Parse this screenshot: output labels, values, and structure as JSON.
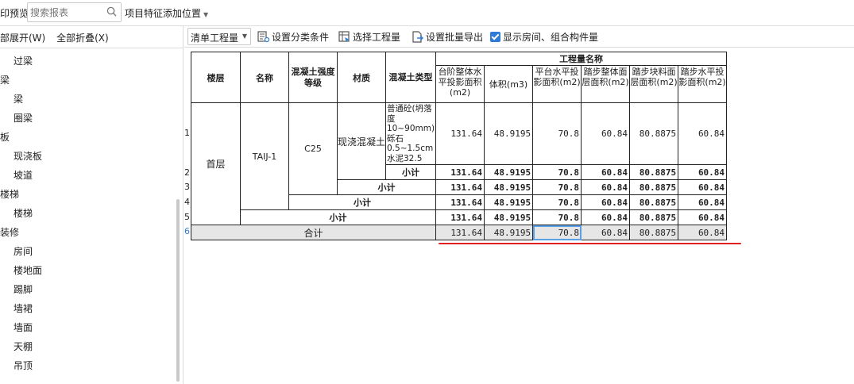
{
  "topbar": {
    "preview_label": "印预览",
    "search_placeholder": "搜索报表",
    "feature_position_label": "项目特征添加位置"
  },
  "left_panel": {
    "expand_all": "部展开(W)",
    "collapse_all": "全部折叠(X)",
    "tree": [
      {
        "label": "过梁",
        "level": 2
      },
      {
        "label": "梁",
        "level": 1
      },
      {
        "label": "梁",
        "level": 2
      },
      {
        "label": "圈梁",
        "level": 2
      },
      {
        "label": "板",
        "level": 1
      },
      {
        "label": "现浇板",
        "level": 2
      },
      {
        "label": "坡道",
        "level": 2
      },
      {
        "label": "楼梯",
        "level": 1
      },
      {
        "label": "楼梯",
        "level": 2
      },
      {
        "label": "装修",
        "level": 1
      },
      {
        "label": "房间",
        "level": 2
      },
      {
        "label": "楼地面",
        "level": 2
      },
      {
        "label": "踢脚",
        "level": 2
      },
      {
        "label": "墙裙",
        "level": 2
      },
      {
        "label": "墙面",
        "level": 2
      },
      {
        "label": "天棚",
        "level": 2
      },
      {
        "label": "吊顶",
        "level": 2
      }
    ]
  },
  "toolbar": {
    "mode_select": "清单工程量",
    "set_category": "设置分类条件",
    "select_quantity": "选择工程量",
    "set_batch_export": "设置批量导出",
    "show_rooms_label": "显示房间、组合构件量"
  },
  "grid": {
    "headers": {
      "floor": "楼层",
      "name": "名称",
      "grade": "混凝土强度等级",
      "material": "材质",
      "concrete_type": "混凝土类型",
      "quantity_group": "工程量名称",
      "q1": "台阶整体水平投影面积(m2)",
      "q2": "体积(m3)",
      "q3": "平台水平投影面积(m2)",
      "q4": "踏步整体面层面积(m2)",
      "q5": "踏步块料面层面积(m2)",
      "q6": "踏步水平投影面积(m2)"
    },
    "row_numbers": [
      "1",
      "2",
      "3",
      "4",
      "5",
      "6"
    ],
    "detail": {
      "floor": "首层",
      "name": "TAIJ-1",
      "grade": "C25",
      "material": "现浇混凝土",
      "concrete_type": "普通砼(坍落度10~90mm) 砾石0.5~1.5cm 水泥32.5",
      "values": [
        "131.64",
        "48.9195",
        "70.8",
        "60.84",
        "80.8875",
        "60.84"
      ]
    },
    "subtotal_label": "小计",
    "total_label": "合计",
    "subtotal_values": [
      "131.64",
      "48.9195",
      "70.8",
      "60.84",
      "80.8875",
      "60.84"
    ],
    "total_values": [
      "131.64",
      "48.9195",
      "70.8",
      "60.84",
      "80.8875",
      "60.84"
    ]
  },
  "colors": {
    "accent": "#2f7bd8",
    "annotation_line": "#e02020",
    "total_row_bg": "#e6e6e6"
  }
}
